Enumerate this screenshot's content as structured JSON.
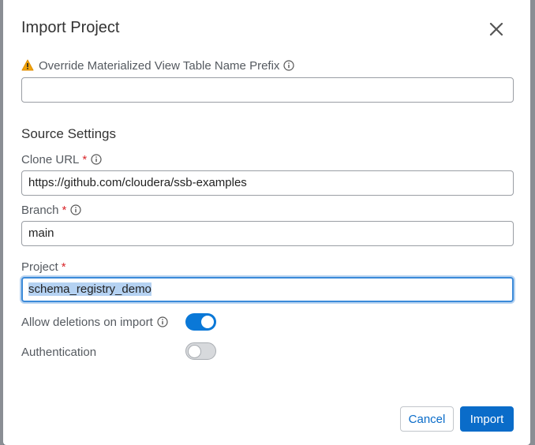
{
  "dialog": {
    "title": "Import Project",
    "close_icon": "close-icon"
  },
  "override_prefix": {
    "label": "Override Materialized View Table Name Prefix",
    "value": "",
    "warning_icon": "warning-icon",
    "info_icon": "info-icon"
  },
  "source_settings": {
    "heading": "Source Settings"
  },
  "clone_url": {
    "label": "Clone URL",
    "required_mark": "*",
    "value": "https://github.com/cloudera/ssb-examples"
  },
  "branch": {
    "label": "Branch",
    "required_mark": "*",
    "value": "main"
  },
  "project": {
    "label": "Project",
    "required_mark": "*",
    "value": "schema_registry_demo"
  },
  "allow_deletions": {
    "label": "Allow deletions on import",
    "enabled": true
  },
  "authentication": {
    "label": "Authentication",
    "enabled": false
  },
  "footer": {
    "cancel_label": "Cancel",
    "import_label": "Import"
  },
  "colors": {
    "primary": "#0a6cc9",
    "toggle_on": "#0a78d7",
    "warning": "#f0a30a",
    "required": "#d9262b",
    "focus_border": "#3b8ad9"
  }
}
